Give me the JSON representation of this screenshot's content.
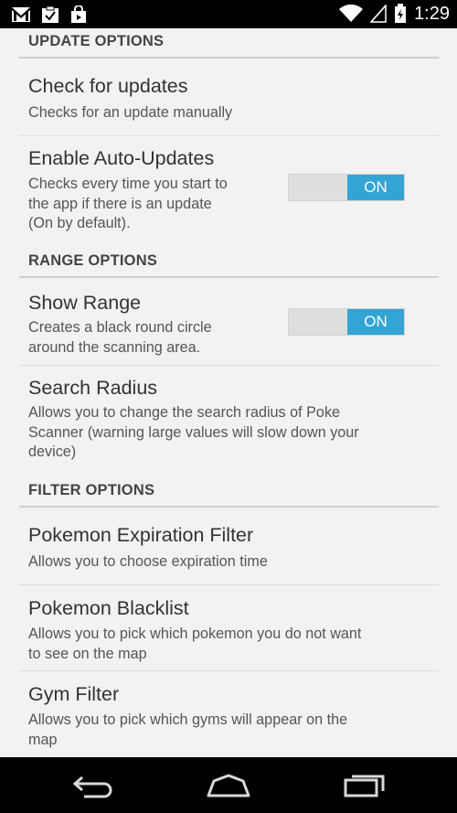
{
  "status_bar": {
    "time": "1:29",
    "left_icons": [
      "gmail-icon",
      "clipboard-icon",
      "shopping-bag-icon"
    ],
    "right_icons": [
      "wifi-icon",
      "signal-icon",
      "battery-icon"
    ]
  },
  "sections": [
    {
      "header": "UPDATE OPTIONS",
      "items": [
        {
          "title": "Check for updates",
          "summary": [
            "Checks for an update manually"
          ]
        },
        {
          "title": "Enable Auto-Updates",
          "summary": [
            "Checks every time you start to",
            "the app if there is an update",
            "(On by default)."
          ],
          "toggle": "ON"
        }
      ]
    },
    {
      "header": "RANGE OPTIONS",
      "items": [
        {
          "title": "Show Range",
          "summary": [
            "Creates a black round circle",
            "around the scanning area."
          ],
          "toggle": "ON"
        },
        {
          "title": "Search Radius",
          "summary": [
            "Allows you to change the search radius of Poke",
            "Scanner (warning large values will slow down your",
            "device)"
          ]
        }
      ]
    },
    {
      "header": "FILTER OPTIONS",
      "items": [
        {
          "title": "Pokemon Expiration Filter",
          "summary": [
            "Allows you to choose expiration time"
          ]
        },
        {
          "title": "Pokemon Blacklist",
          "summary": [
            "Allows you to pick which pokemon you do not want",
            "to see on the map"
          ]
        },
        {
          "title": "Gym Filter",
          "summary": [
            "Allows you to pick which gyms will appear on the",
            "map"
          ]
        }
      ]
    }
  ],
  "nav_bar": {
    "icons": [
      "back-icon",
      "home-icon",
      "recents-icon"
    ]
  },
  "colors": {
    "toggle_on": "#33a4d4",
    "background": "#f2f2f2"
  }
}
